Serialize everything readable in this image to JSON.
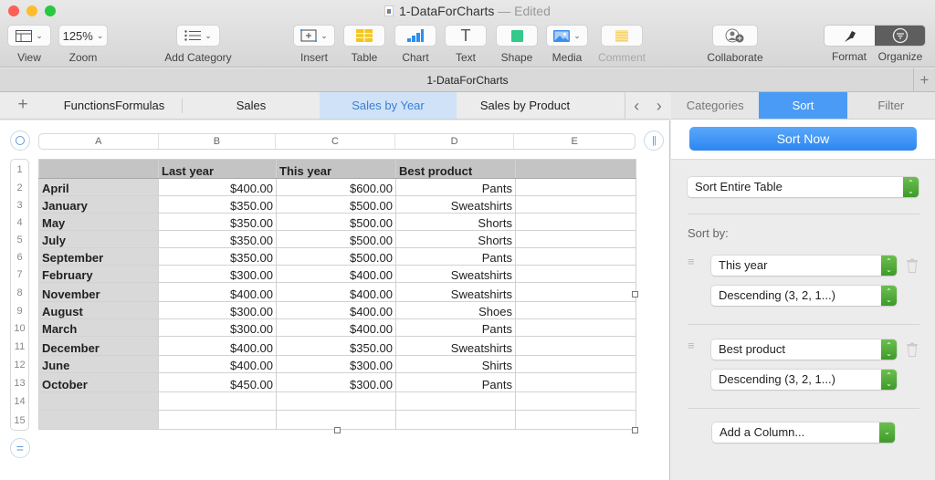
{
  "window": {
    "title": "1-DataForCharts",
    "edited_label": "— Edited",
    "traffic_lights": {
      "close": "#fc5f57",
      "minimize": "#fdbc2e",
      "zoom": "#28c840"
    }
  },
  "toolbar": {
    "view": {
      "label": "View",
      "icon": "sidebar-view-icon"
    },
    "zoom": {
      "label": "Zoom",
      "value": "125%"
    },
    "add_category": {
      "label": "Add Category",
      "icon": "list-icon"
    },
    "insert": {
      "label": "Insert",
      "icon": "insert-plus-icon"
    },
    "table": {
      "label": "Table",
      "icon": "table-icon",
      "color": "#f5c518"
    },
    "chart": {
      "label": "Chart",
      "icon": "bar-chart-icon",
      "color": "#2e8ef2"
    },
    "text": {
      "label": "Text",
      "icon": "text-t-icon"
    },
    "shape": {
      "label": "Shape",
      "icon": "square-shape-icon",
      "color": "#34c98a"
    },
    "media": {
      "label": "Media",
      "icon": "photo-icon"
    },
    "comment": {
      "label": "Comment",
      "icon": "note-icon"
    },
    "collaborate": {
      "label": "Collaborate",
      "icon": "add-person-icon"
    },
    "format": {
      "label": "Format",
      "icon": "paintbrush-icon"
    },
    "organize": {
      "label": "Organize",
      "icon": "filter-circle-icon"
    }
  },
  "doc_bar": {
    "title": "1-DataForCharts",
    "add_label": "+"
  },
  "sheet_tabs": {
    "add_label": "+",
    "tabs": [
      {
        "label": "FunctionsFormulas",
        "active": false
      },
      {
        "label": "Sales",
        "active": false
      },
      {
        "label": "Sales by Year",
        "active": true
      },
      {
        "label": "Sales by Product",
        "active": false
      }
    ],
    "prev": "‹",
    "next": "›"
  },
  "sheet": {
    "columns": [
      "A",
      "B",
      "C",
      "D",
      "E"
    ],
    "row_numbers": [
      "1",
      "2",
      "3",
      "4",
      "5",
      "6",
      "7",
      "8",
      "9",
      "10",
      "11",
      "12",
      "13",
      "14",
      "15"
    ],
    "header": [
      "",
      "Last year",
      "This year",
      "Best product",
      ""
    ],
    "rows": [
      [
        "April",
        "$400.00",
        "$600.00",
        "Pants",
        ""
      ],
      [
        "January",
        "$350.00",
        "$500.00",
        "Sweatshirts",
        ""
      ],
      [
        "May",
        "$350.00",
        "$500.00",
        "Shorts",
        ""
      ],
      [
        "July",
        "$350.00",
        "$500.00",
        "Shorts",
        ""
      ],
      [
        "September",
        "$350.00",
        "$500.00",
        "Pants",
        ""
      ],
      [
        "February",
        "$300.00",
        "$400.00",
        "Sweatshirts",
        ""
      ],
      [
        "November",
        "$400.00",
        "$400.00",
        "Sweatshirts",
        ""
      ],
      [
        "August",
        "$300.00",
        "$400.00",
        "Shoes",
        ""
      ],
      [
        "March",
        "$300.00",
        "$400.00",
        "Pants",
        ""
      ],
      [
        "December",
        "$400.00",
        "$350.00",
        "Sweatshirts",
        ""
      ],
      [
        "June",
        "$400.00",
        "$300.00",
        "Shirts",
        ""
      ],
      [
        "October",
        "$450.00",
        "$300.00",
        "Pants",
        ""
      ],
      [
        "",
        "",
        "",
        "",
        ""
      ],
      [
        "",
        "",
        "",
        "",
        ""
      ]
    ]
  },
  "sidebar": {
    "tabs": [
      {
        "label": "Categories",
        "active": false
      },
      {
        "label": "Sort",
        "active": true
      },
      {
        "label": "Filter",
        "active": false
      }
    ],
    "sort_now": "Sort Now",
    "scope": "Sort Entire Table",
    "sort_by_label": "Sort by:",
    "rules": [
      {
        "column": "This year",
        "order": "Descending (3, 2, 1...)"
      },
      {
        "column": "Best product",
        "order": "Descending (3, 2, 1...)"
      }
    ],
    "add_column": "Add a Column..."
  }
}
